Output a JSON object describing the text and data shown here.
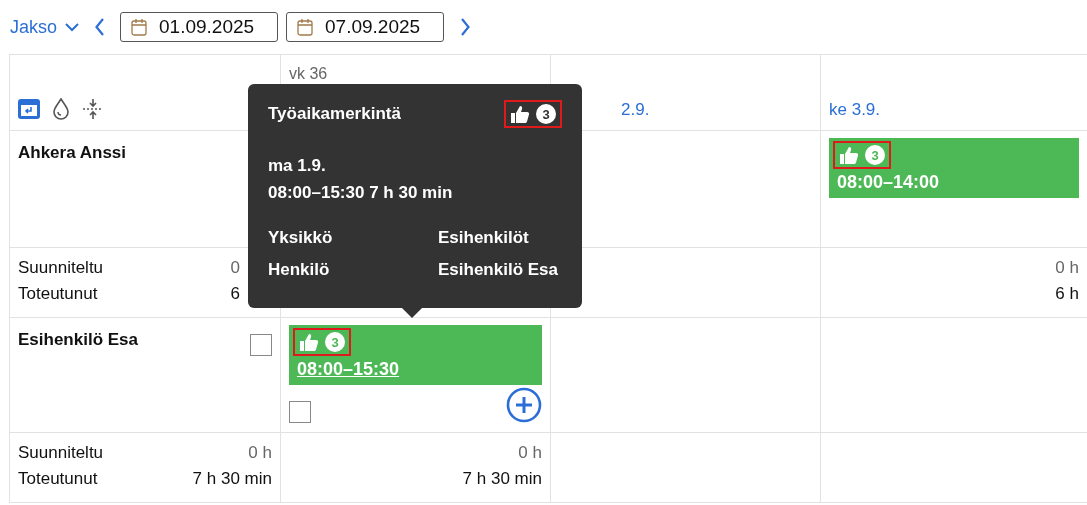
{
  "toolbar": {
    "period_label": "Jakso",
    "start_date": "01.09.2025",
    "end_date": "07.09.2025"
  },
  "days": [
    {
      "week": "vk 36"
    },
    {
      "label": "2.9."
    },
    {
      "label": "ke 3.9."
    }
  ],
  "people": [
    {
      "name": "Ahkera Anssi",
      "cells": [
        null,
        null,
        {
          "entry": {
            "approvals": "3",
            "highlighted": true,
            "time": "08:00–14:00",
            "underlined": false
          },
          "day_planned": "0 h",
          "day_actual": "6 h"
        }
      ],
      "summary": {
        "planned_label": "Suunniteltu",
        "planned": "0",
        "actual_label": "Toteutunut",
        "actual": "6"
      }
    },
    {
      "name": "Esihenkilö Esa",
      "checked": false,
      "cells": [
        {
          "entry": {
            "approvals": "3",
            "highlighted": true,
            "time": "08:00–15:30",
            "underlined": true
          },
          "checked": false,
          "add": true,
          "day_planned": "0 h",
          "day_actual": "7 h 30 min"
        },
        null,
        null
      ],
      "summary": {
        "planned_label": "Suunniteltu",
        "planned": "0 h",
        "actual_label": "Toteutunut",
        "actual": "7 h 30 min"
      }
    }
  ],
  "tooltip": {
    "title": "Työaikamerkintä",
    "approvals": "3",
    "highlighted": true,
    "date": "ma 1.9.",
    "time": "08:00–15:30 7 h 30 min",
    "fields": [
      {
        "label": "Yksikkö",
        "value": "Esihenkilöt"
      },
      {
        "label": "Henkilö",
        "value": "Esihenkilö Esa"
      }
    ]
  }
}
